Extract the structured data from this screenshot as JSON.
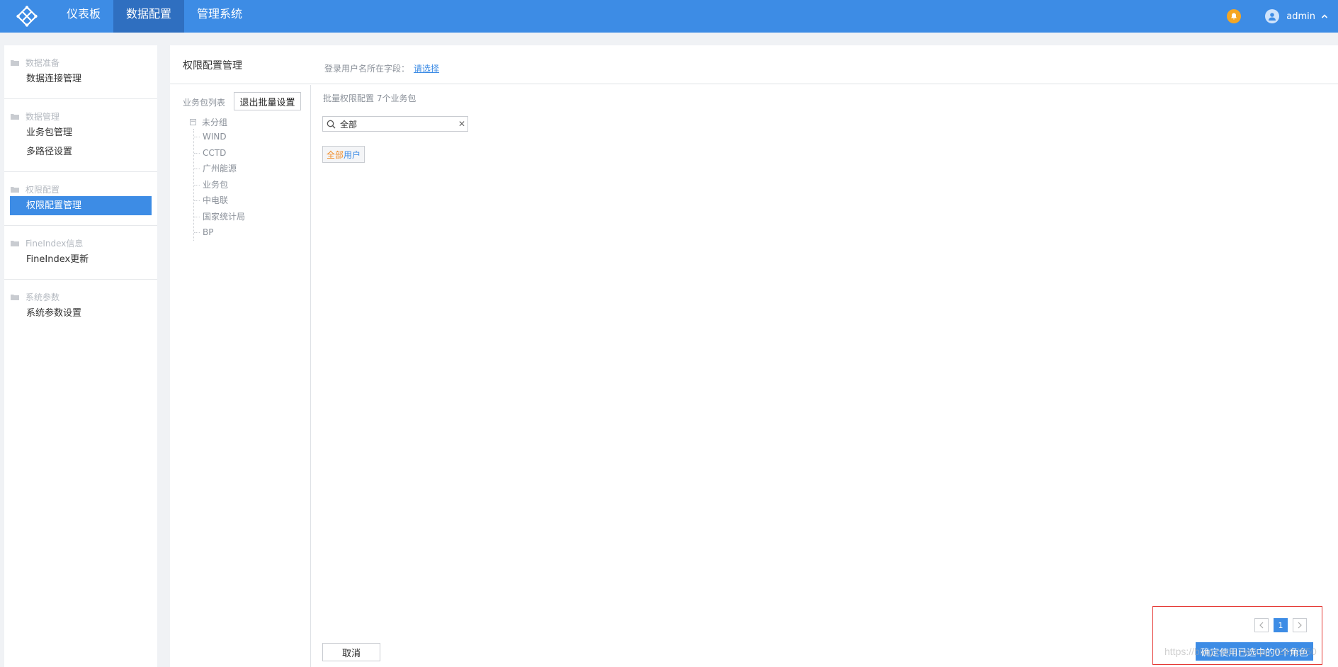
{
  "topnav": {
    "tabs": [
      {
        "label": "仪表板",
        "active": false
      },
      {
        "label": "数据配置",
        "active": true
      },
      {
        "label": "管理系统",
        "active": false
      }
    ],
    "username": "admin",
    "accent": "#3d8ce5"
  },
  "sidebar": {
    "groups": [
      {
        "title": "数据准备",
        "items": [
          {
            "label": "数据连接管理",
            "active": false
          }
        ]
      },
      {
        "title": "数据管理",
        "items": [
          {
            "label": "业务包管理",
            "active": false
          },
          {
            "label": "多路径设置",
            "active": false
          }
        ]
      },
      {
        "title": "权限配置",
        "items": [
          {
            "label": "权限配置管理",
            "active": true
          }
        ]
      },
      {
        "title": "FineIndex信息",
        "items": [
          {
            "label": "FineIndex更新",
            "active": false
          }
        ]
      },
      {
        "title": "系统参数",
        "items": [
          {
            "label": "系统参数设置",
            "active": false
          }
        ]
      }
    ]
  },
  "main": {
    "title": "权限配置管理",
    "login_field_label": "登录用户名所在字段：",
    "login_field_link": "请选择",
    "package_list_label": "业务包列表",
    "exit_batch_label": "退出批量设置",
    "tree": {
      "root": "未分组",
      "children": [
        "WIND",
        "CCTD",
        "广州能源",
        "业务包",
        "中电联",
        "国家统计局",
        "BP"
      ]
    },
    "batch_title": "批量权限配置 7个业务包",
    "search_value": "全部",
    "all_users_part1": "全部",
    "all_users_part2": "用户",
    "cancel_label": "取消",
    "pager": {
      "current": "1"
    },
    "confirm_label": "确定使用已选中的0个角色",
    "watermark": "https://blog.csdn.net/qq_42492950"
  }
}
